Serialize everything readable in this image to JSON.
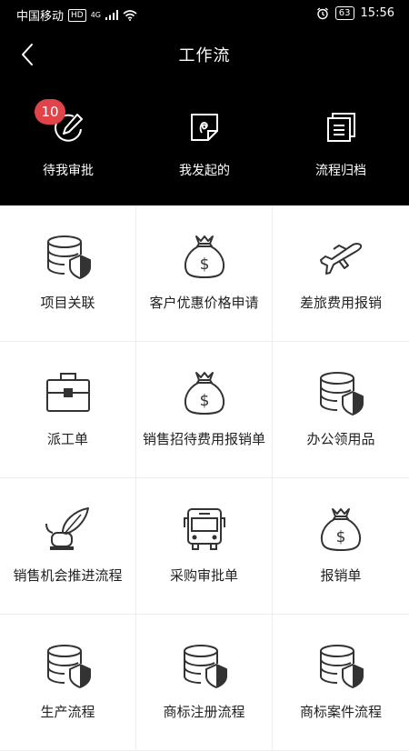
{
  "status_bar": {
    "carrier": "中国移动",
    "hd": "HD",
    "network": "4G",
    "battery": "63",
    "time": "15:56"
  },
  "header": {
    "title": "工作流",
    "tabs": [
      {
        "label": "待我审批",
        "icon": "edit-icon",
        "badge": "10"
      },
      {
        "label": "我发起的",
        "icon": "document-icon"
      },
      {
        "label": "流程归档",
        "icon": "archive-icon"
      }
    ]
  },
  "grid": [
    {
      "label": "项目关联",
      "icon": "database-shield-icon"
    },
    {
      "label": "客户优惠价格申请",
      "icon": "money-bag-icon"
    },
    {
      "label": "差旅费用报销",
      "icon": "airplane-icon"
    },
    {
      "label": "派工单",
      "icon": "briefcase-icon"
    },
    {
      "label": "销售招待费用报销单",
      "icon": "money-bag-icon"
    },
    {
      "label": "办公领用品",
      "icon": "database-shield-icon"
    },
    {
      "label": "销售机会推进流程",
      "icon": "quill-ink-icon"
    },
    {
      "label": "采购审批单",
      "icon": "bus-icon"
    },
    {
      "label": "报销单",
      "icon": "money-bag-icon"
    },
    {
      "label": "生产流程",
      "icon": "database-shield-icon"
    },
    {
      "label": "商标注册流程",
      "icon": "database-shield-icon"
    },
    {
      "label": "商标案件流程",
      "icon": "database-shield-icon"
    }
  ]
}
